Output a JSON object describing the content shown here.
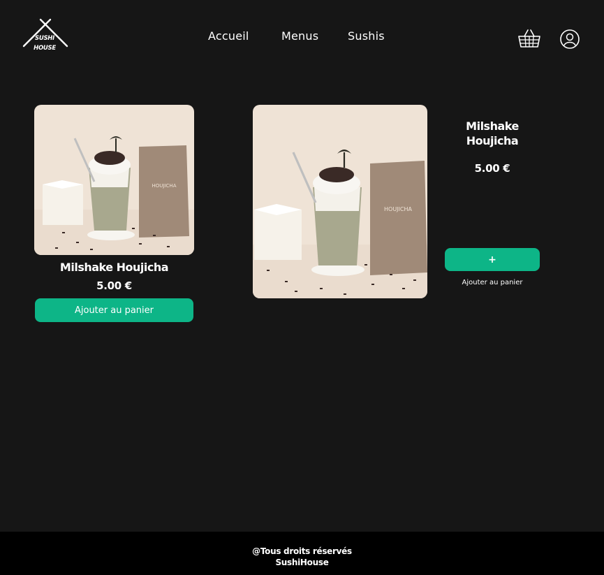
{
  "brand": {
    "logo_text_line1": "SUSHI",
    "logo_text_line2": "HOUSE"
  },
  "nav": {
    "items": [
      {
        "label": "Accueil"
      },
      {
        "label": "Menus"
      },
      {
        "label": "Sushis"
      }
    ]
  },
  "header_icons": {
    "cart": "basket-icon",
    "account": "user-icon"
  },
  "product_card": {
    "name": "Milshake Houjicha",
    "price": "5.00 €",
    "button_label": "Ajouter au panier",
    "image_icon": "milkshake-image",
    "package_label": "HOUJICHA"
  },
  "product_detail": {
    "name_line1": "Milshake",
    "name_line2": "Houjicha",
    "price": "5.00 €",
    "add_button_label": "+",
    "add_caption": "Ajouter au panier",
    "package_label": "HOUJICHA"
  },
  "footer": {
    "line1": "@Tous droits réservés",
    "line2": "SushiHouse"
  },
  "colors": {
    "background": "#161616",
    "accent": "#0db587",
    "footer": "#000000",
    "image_bg": "#efe3d6"
  }
}
